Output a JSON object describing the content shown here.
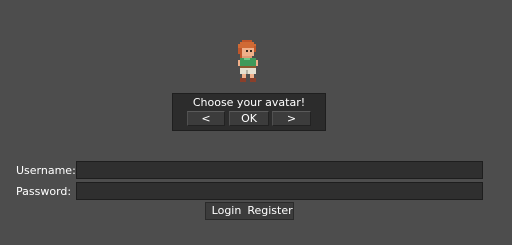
{
  "avatar_selector": {
    "title": "Choose your avatar!",
    "prev_label": "<",
    "ok_label": "OK",
    "next_label": ">"
  },
  "login_form": {
    "username_label": "Username:",
    "username_value": "",
    "password_label": "Password:",
    "password_value": "",
    "login_label": "Login",
    "register_label": "Register"
  },
  "colors": {
    "background": "#4d4d4d",
    "panel": "#2c2c2c",
    "button": "#3c3c3c",
    "input": "#2f2f2f",
    "text": "#ffffff"
  },
  "icons": {
    "avatar": "pixel-character-avatar-icon"
  }
}
